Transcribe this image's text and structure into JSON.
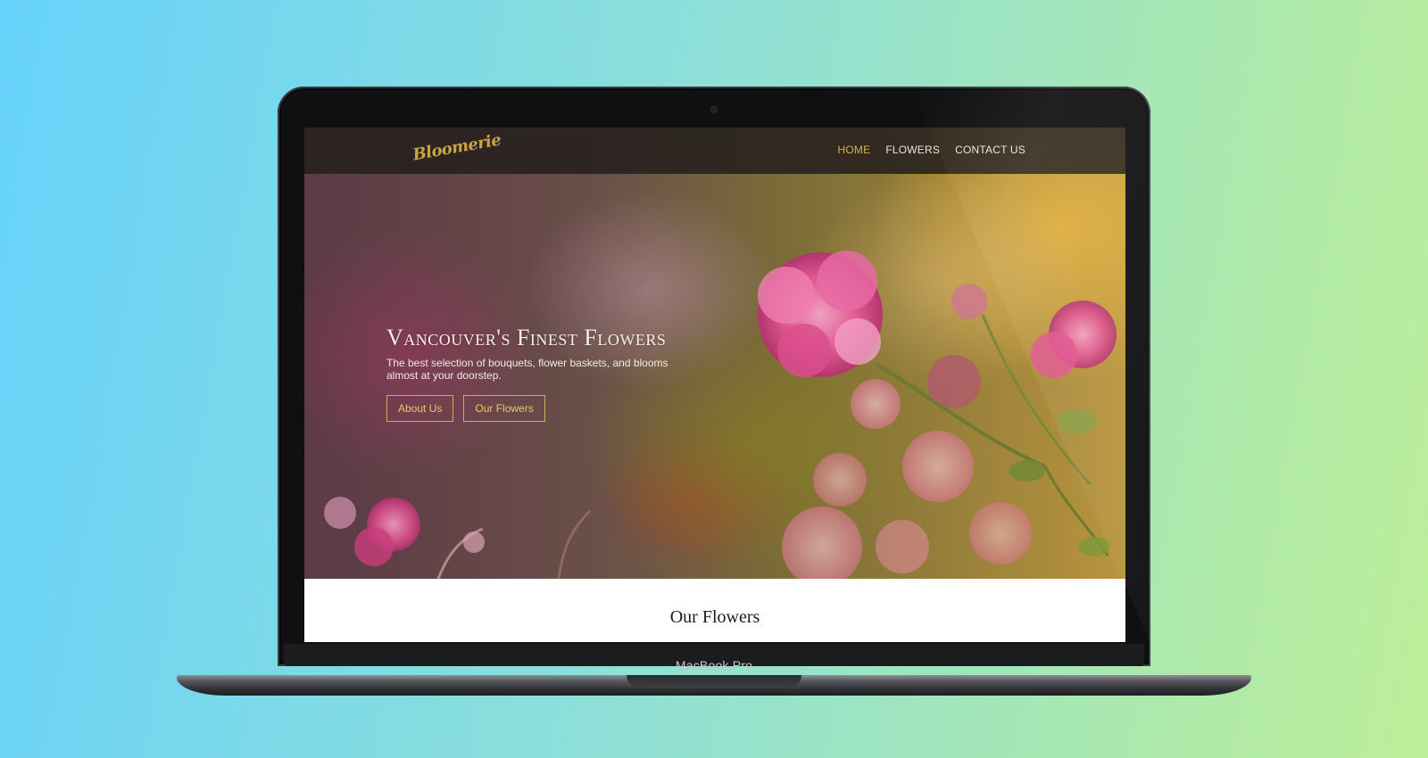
{
  "device": {
    "model_label": "MacBook Pro"
  },
  "site": {
    "logo_text": "Bloomerie",
    "nav": {
      "items": [
        {
          "label": "HOME",
          "active": true
        },
        {
          "label": "FLOWERS",
          "active": false
        },
        {
          "label": "CONTACT US",
          "active": false
        }
      ]
    },
    "hero": {
      "title": "Vancouver's Finest Flowers",
      "subtitle": "The best selection of bouquets, flower baskets, and blooms almost at your doorstep.",
      "buttons": {
        "about": "About Us",
        "flowers": "Our Flowers"
      }
    },
    "section_title": "Our Flowers"
  },
  "colors": {
    "accent_gold": "#d6b24a",
    "background_gradient_left": "#66d2fb",
    "background_gradient_right": "#bdee98"
  }
}
